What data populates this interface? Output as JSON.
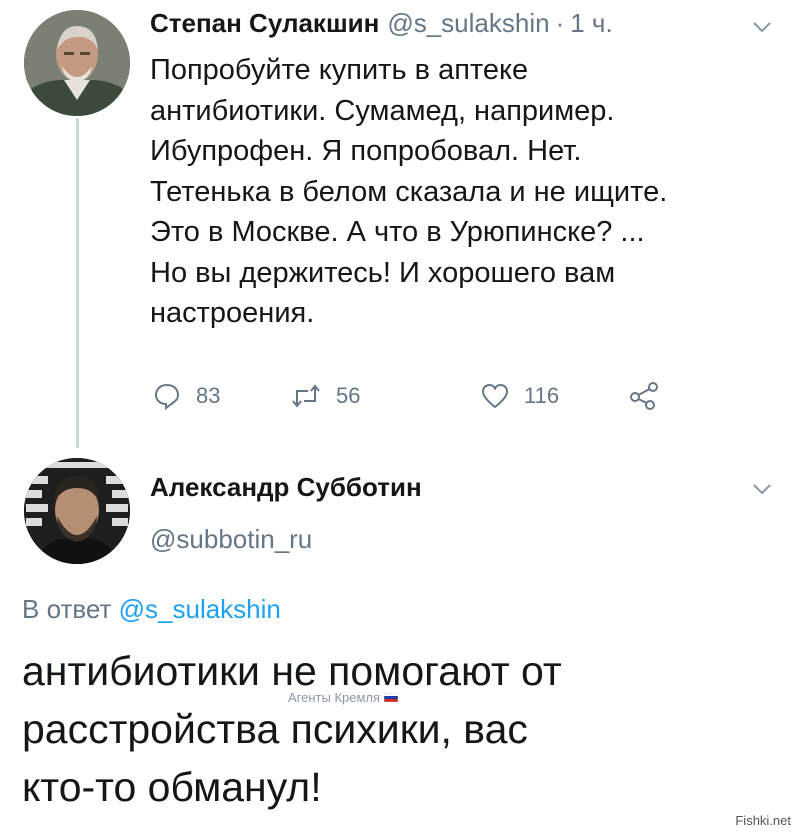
{
  "tweet1": {
    "author_name": "Степан Сулакшин",
    "handle": "@s_sulakshin",
    "separator": "·",
    "time": "1 ч.",
    "body_lines": [
      "Попробуйте купить в аптеке",
      "антибиотики. Сумамед, например.",
      "Ибупрофен. Я попробовал. Нет.",
      "Тетенька в белом сказала и не ищите.",
      "Это в Москве. А что в Урюпинске?  ...",
      "Но вы держитесь! И хорошего вам",
      "настроения."
    ],
    "actions": {
      "replies": "83",
      "retweets": "56",
      "likes": "116"
    },
    "icons": [
      "reply-icon",
      "retweet-icon",
      "like-icon",
      "share-icon",
      "chevron-down-icon"
    ]
  },
  "tweet2": {
    "author_name": "Александр Субботин",
    "handle": "@subbotin_ru",
    "reply_prefix": "В ответ",
    "reply_handle": "@s_sulakshin",
    "body_lines": [
      "антибиотики не помогают от",
      "расстройства психики, вас",
      "кто-то обманул!"
    ]
  },
  "overlay_label": "Агенты Кремля",
  "watermark": "Fishki.net",
  "colors": {
    "text": "#14171a",
    "secondary": "#657786",
    "link": "#1da1f2",
    "thread_line": "#ccd6dd"
  }
}
